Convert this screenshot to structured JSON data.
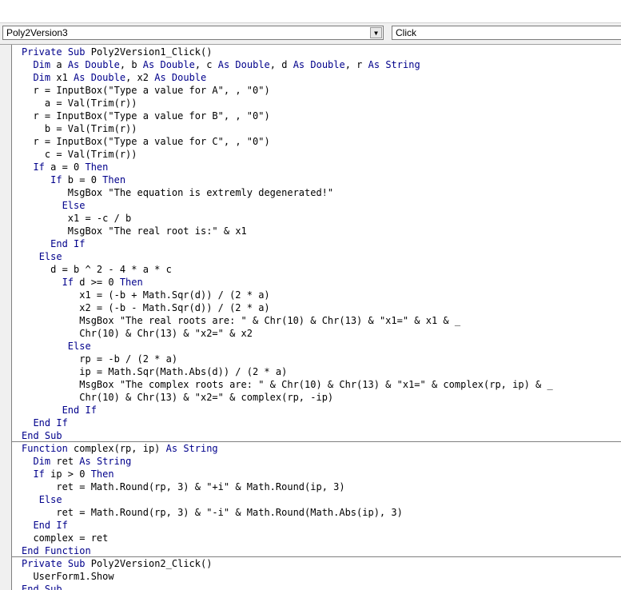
{
  "toolbar": {
    "object_combo": "Poly2Version3",
    "procedure_combo": "Click"
  },
  "colors": {
    "keyword": "#00008b",
    "text": "#000000",
    "separator": "#808080"
  },
  "code_lines": [
    "Private Sub Poly2Version1_Click()",
    "  Dim a As Double, b As Double, c As Double, d As Double, r As String",
    "  Dim x1 As Double, x2 As Double",
    "  r = InputBox(\"Type a value for A\", , \"0\")",
    "    a = Val(Trim(r))",
    "  r = InputBox(\"Type a value for B\", , \"0\")",
    "    b = Val(Trim(r))",
    "  r = InputBox(\"Type a value for C\", , \"0\")",
    "    c = Val(Trim(r))",
    "  If a = 0 Then",
    "     If b = 0 Then",
    "        MsgBox \"The equation is extremly degenerated!\"",
    "       Else",
    "        x1 = -c / b",
    "        MsgBox \"The real root is:\" & x1",
    "     End If",
    "   Else",
    "     d = b ^ 2 - 4 * a * c",
    "       If d >= 0 Then",
    "          x1 = (-b + Math.Sqr(d)) / (2 * a)",
    "          x2 = (-b - Math.Sqr(d)) / (2 * a)",
    "          MsgBox \"The real roots are: \" & Chr(10) & Chr(13) & \"x1=\" & x1 & _",
    "          Chr(10) & Chr(13) & \"x2=\" & x2",
    "        Else",
    "          rp = -b / (2 * a)",
    "          ip = Math.Sqr(Math.Abs(d)) / (2 * a)",
    "          MsgBox \"The complex roots are: \" & Chr(10) & Chr(13) & \"x1=\" & complex(rp, ip) & _",
    "          Chr(10) & Chr(13) & \"x2=\" & complex(rp, -ip)",
    "       End If",
    "  End If",
    "End Sub",
    "Function complex(rp, ip) As String",
    "  Dim ret As String",
    "  If ip > 0 Then",
    "      ret = Math.Round(rp, 3) & \"+i\" & Math.Round(ip, 3)",
    "   Else",
    "      ret = Math.Round(rp, 3) & \"-i\" & Math.Round(Math.Abs(ip), 3)",
    "  End If",
    "  complex = ret",
    "End Function",
    "Private Sub Poly2Version2_Click()",
    "  UserForm1.Show",
    "End Sub"
  ]
}
